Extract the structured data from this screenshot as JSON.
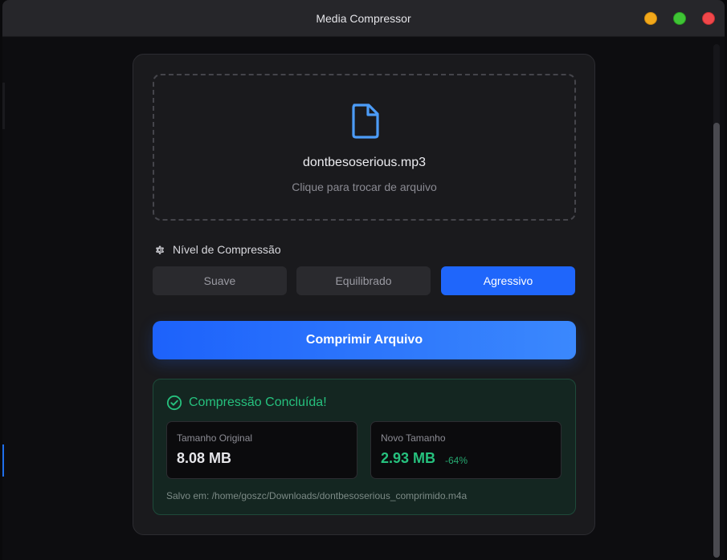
{
  "window": {
    "title": "Media Compressor"
  },
  "dropzone": {
    "icon": "file-icon",
    "filename": "dontbesoserious.mp3",
    "hint": "Clique para trocar de arquivo"
  },
  "compression": {
    "label": "Nível de Compressão",
    "icon": "gear-icon",
    "options": [
      "Suave",
      "Equilibrado",
      "Agressivo"
    ],
    "selected": "Agressivo"
  },
  "action": {
    "label": "Comprimir Arquivo"
  },
  "result": {
    "title": "Compressão Concluída!",
    "original_label": "Tamanho Original",
    "original_value": "8.08 MB",
    "new_label": "Novo Tamanho",
    "new_value": "2.93 MB",
    "reduction": "-64%",
    "saved_path": "Salvo em: /home/goszc/Downloads/dontbesoserious_comprimido.m4a"
  },
  "colors": {
    "accent": "#1f66fb",
    "success": "#26c17e",
    "window_close": "#f0474a",
    "window_maximize": "#3fc435",
    "window_minimize": "#f2a81a"
  }
}
